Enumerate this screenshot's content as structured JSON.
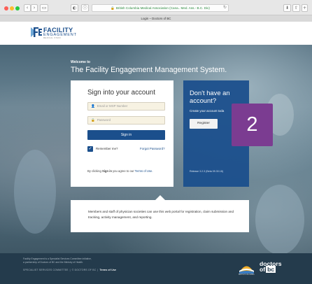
{
  "browser": {
    "address": "British Columbia Medical Association (Cana.. Med. Ass.- B.C. Div)",
    "tab_title": "Login – Doctors of BC",
    "back": "‹",
    "forward": "›"
  },
  "logo": {
    "line1": "FACILITY",
    "line2": "ENGAGEMENT",
    "line3": "MEDICAL STAFF"
  },
  "hero": {
    "welcome_small": "Welcome to",
    "welcome_big": "The Facility Engagement Management System."
  },
  "signin": {
    "title": "Sign into your account",
    "email_placeholder": "Email or MSP Number",
    "password_placeholder": "Password",
    "button": "Sign in",
    "remember": "Remember me?",
    "forgot": "Forgot Password?",
    "terms_prefix": "By clicking ",
    "terms_bold": "Sign in",
    "terms_mid": " you agree to our ",
    "terms_link": "Terms of Use."
  },
  "register": {
    "title": "Don't have an account?",
    "subtitle": "Create your account toda",
    "button": "Register",
    "release": "Release 3.2.3 (Beta 09.30.18)"
  },
  "step_badge": "2",
  "info": {
    "text": "Members and staff of physician societies can use this web portal for registration, claim submission and tracking, activity management, and reporting."
  },
  "footer": {
    "line1": "Facility Engagement is a Specialist Services Committee initiative,",
    "line2": "a partnership of Doctors of BC and the Ministry of Health.",
    "link_ssc": "SPECIALIST SERVICES COMMITTEE",
    "link_dobc": "© DOCTORS OF BC",
    "link_terms": "Terms of Use",
    "bc_text": "BRITISH COLUMBIA",
    "docs_line1": "doctors",
    "docs_of": "of",
    "docs_bc": "bc"
  },
  "colors": {
    "brand_blue": "#1b4f8c",
    "badge_purple": "#7b3c91",
    "footer_bg": "#243b4c"
  }
}
